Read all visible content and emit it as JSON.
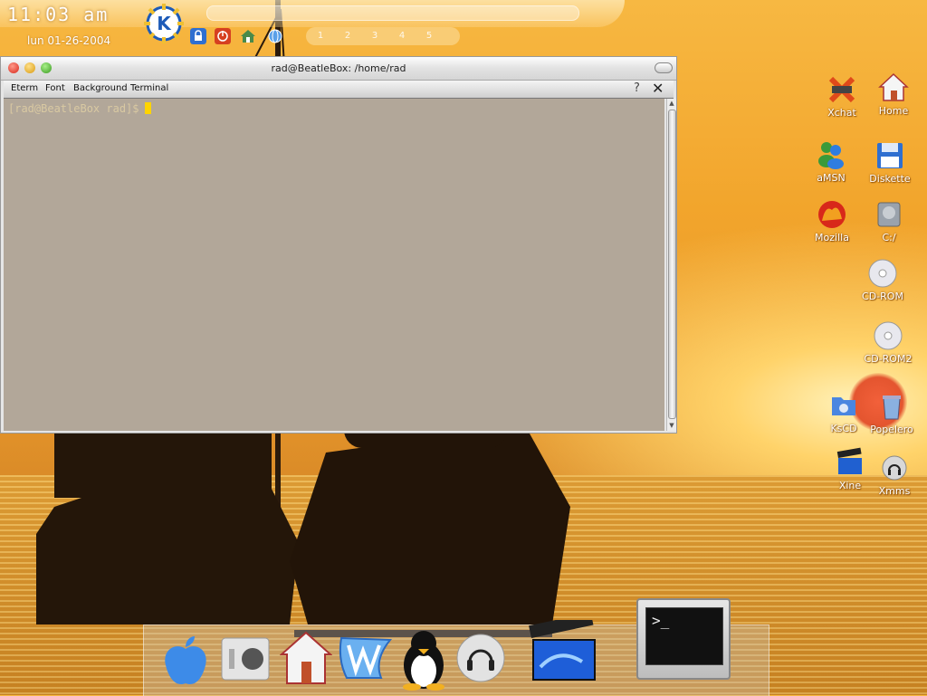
{
  "top_panel": {
    "clock": "11:03 am",
    "date": "lun 01-26-2004",
    "pager": [
      "1",
      "2",
      "3",
      "4",
      "5"
    ]
  },
  "terminal": {
    "title": "rad@BeatleBox: /home/rad",
    "menu": [
      "Eterm",
      "Font",
      "Background",
      "Terminal"
    ],
    "help_glyph": "?",
    "close_glyph": "✕",
    "prompt": "[rad@BeatleBox rad]$"
  },
  "desktop_icons": [
    {
      "label": "Xchat",
      "icon": "xchat-icon"
    },
    {
      "label": "Home",
      "icon": "home-icon"
    },
    {
      "label": "aMSN",
      "icon": "amsn-icon"
    },
    {
      "label": "Diskette",
      "icon": "diskette-icon"
    },
    {
      "label": "Mozilla",
      "icon": "mozilla-icon"
    },
    {
      "label": "C:/",
      "icon": "hard-drive-icon"
    },
    {
      "label": "CD-ROM",
      "icon": "cdrom-icon"
    },
    {
      "label": "CD-ROM2",
      "icon": "cdrom-icon"
    },
    {
      "label": "KsCD",
      "icon": "kscd-icon"
    },
    {
      "label": "Popelero",
      "icon": "trash-icon"
    },
    {
      "label": "Xine",
      "icon": "xine-icon"
    },
    {
      "label": "Xmms",
      "icon": "xmms-icon"
    }
  ],
  "dock": {
    "items": [
      "apple-logo-icon",
      "system-preferences-icon",
      "home-icon",
      "mail-icon",
      "tux-penguin-icon",
      "headphones-icon",
      "clapperboard-icon",
      "terminal-icon"
    ],
    "terminal_glyph": ">_"
  }
}
